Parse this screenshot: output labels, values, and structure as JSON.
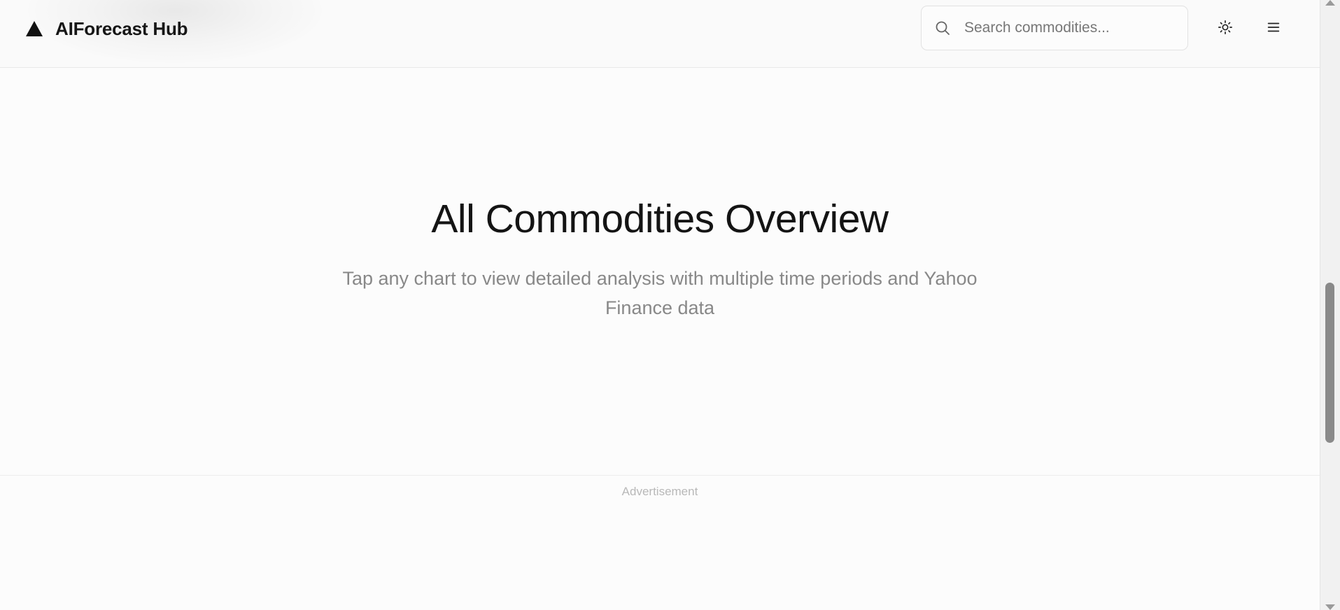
{
  "header": {
    "brand_name": "AIForecast Hub",
    "logo_icon": "triangle-logo-icon",
    "search": {
      "placeholder": "Search commodities...",
      "value": "",
      "icon": "search-icon"
    },
    "theme_toggle_icon": "sun-icon",
    "menu_icon": "hamburger-menu-icon"
  },
  "hero": {
    "title": "All Commodities Overview",
    "subtitle": "Tap any chart to view detailed analysis with multiple time periods and Yahoo Finance data"
  },
  "ad": {
    "label": "Advertisement"
  },
  "colors": {
    "background": "#fcfcfc",
    "header_background": "#fafafa",
    "title_text": "#141414",
    "subtitle_text": "#888888",
    "ad_label_text": "#b8b8b8",
    "scrollbar_thumb": "#8a8a8a"
  }
}
